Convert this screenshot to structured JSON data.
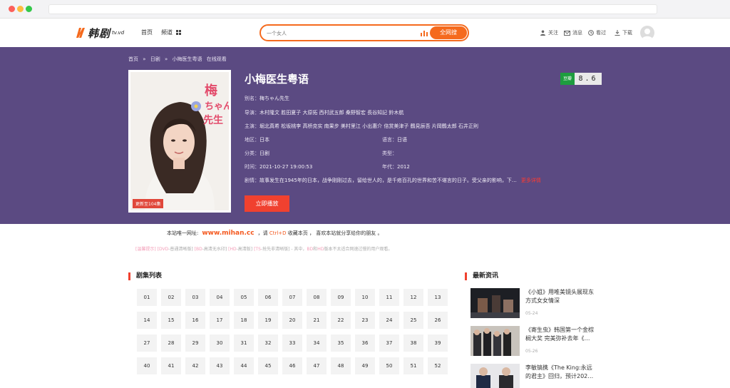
{
  "header": {
    "logo_text": "韩剧",
    "logo_sub": "tv.vd",
    "nav": [
      "首页",
      "频道"
    ],
    "search": {
      "placeholder": "一个女人",
      "button": "全网搜"
    },
    "tools": [
      "关注",
      "消息",
      "看过",
      "下载"
    ]
  },
  "breadcrumb": [
    "首页",
    "»",
    "日剧",
    "»",
    "小梅医生粤语",
    "在线观看"
  ],
  "detail": {
    "title": "小梅医生粤语",
    "update_badge": "更新至104集",
    "douban_label": "豆瓣",
    "douban_score": "8.6",
    "alias_label": "别名：",
    "alias": "梅ちゃん先生",
    "director_label": "导演：",
    "director": "木村隆文 胜田夏子 大原拓 西村武五郎 桑野智宏 長谷知記 鈴木航",
    "cast_label": "主演：",
    "cast": "堀北真希 松坂桃李 高桥克实 南果步 美村里江 小出惠介 倍赏美津子 鶴見辰吾 片岡鶴太郎 石井正則",
    "region_label": "地区：",
    "region": "日本",
    "language_label": "语言：",
    "language": "日语",
    "category_label": "分类：",
    "category": "日剧",
    "type_label": "类型：",
    "type": "",
    "time_label": "时间：",
    "time": "2021-10-27 19:00:53",
    "year_label": "年代：",
    "year": "2012",
    "plot_label": "剧情：",
    "plot": "故事发生在1945年的日本，战争刚刚过去，留给世人的，是千疮百孔的世界和苦不堪言的日子。受父亲的影响，下…",
    "plot_more": "更多详情",
    "play_button": "立即播放"
  },
  "notice": {
    "prefix": "本站唯一网址:",
    "url": "www.mihan.cc",
    "mid": "，请",
    "hotkey": "Ctrl+D",
    "suffix": "收藏本页 ， 喜欢本站就分享给你的朋友 。"
  },
  "tips": {
    "label": "[温馨提示]",
    "dvd": "[DVD",
    "dvd_t": "-普通清晰版]",
    "bd": "[BD",
    "bd_t": "-高清无水印]",
    "hd": "[HD",
    "hd_t": "-高清版]",
    "ts": "[TS",
    "ts_t": "-抢先非清晰版]",
    "tail1": "- 其中，",
    "bd2": "BD",
    "and": "和",
    "hd2": "HD",
    "tail2": "版本不太适合网速过慢的用户观看。"
  },
  "episodes": {
    "heading": "剧集列表",
    "list": [
      "01",
      "02",
      "03",
      "04",
      "05",
      "06",
      "07",
      "08",
      "09",
      "10",
      "11",
      "12",
      "13",
      "14",
      "15",
      "16",
      "17",
      "18",
      "19",
      "20",
      "21",
      "22",
      "23",
      "24",
      "25",
      "26",
      "27",
      "28",
      "29",
      "30",
      "31",
      "32",
      "33",
      "34",
      "35",
      "36",
      "37",
      "38",
      "39",
      "40",
      "41",
      "42",
      "43",
      "44",
      "45",
      "46",
      "47",
      "48",
      "49",
      "50",
      "51",
      "52"
    ]
  },
  "news": {
    "heading": "最新资讯",
    "items": [
      {
        "title": "《小姐》用唯美镜头展现东方式女女情深",
        "date": "05-24"
      },
      {
        "title": "《寄生虫》韩国第一个金棕榈大奖 完美弥补去年《…",
        "date": "05-26"
      },
      {
        "title": "李敏镐携《The King:永远的君主》回归，预计202…",
        "date": ""
      }
    ]
  }
}
